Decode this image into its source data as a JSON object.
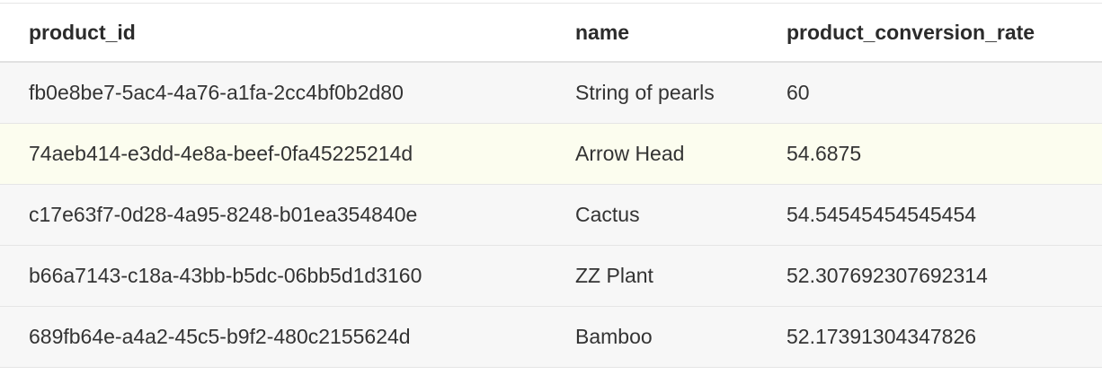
{
  "table": {
    "columns": [
      "product_id",
      "name",
      "product_conversion_rate"
    ],
    "rows": [
      {
        "product_id": "fb0e8be7-5ac4-4a76-a1fa-2cc4bf0b2d80",
        "name": "String of pearls",
        "product_conversion_rate": "60"
      },
      {
        "product_id": "74aeb414-e3dd-4e8a-beef-0fa45225214d",
        "name": "Arrow Head",
        "product_conversion_rate": "54.6875"
      },
      {
        "product_id": "c17e63f7-0d28-4a95-8248-b01ea354840e",
        "name": "Cactus",
        "product_conversion_rate": "54.54545454545454"
      },
      {
        "product_id": "b66a7143-c18a-43bb-b5dc-06bb5d1d3160",
        "name": "ZZ Plant",
        "product_conversion_rate": "52.307692307692314"
      },
      {
        "product_id": "689fb64e-a4a2-45c5-b9f2-480c2155624d",
        "name": "Bamboo",
        "product_conversion_rate": "52.17391304347826"
      }
    ],
    "highlight_color": "#fcfdef",
    "row_color": "#f7f7f7"
  }
}
